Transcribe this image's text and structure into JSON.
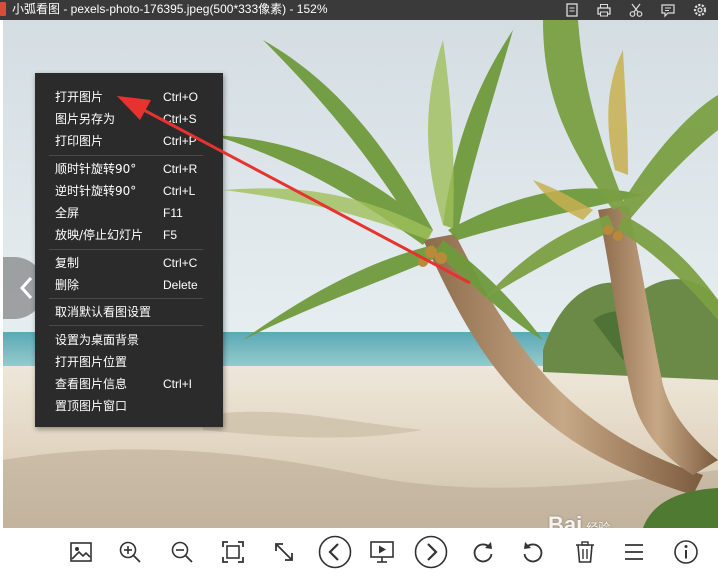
{
  "window": {
    "title": "小弧看图 - pexels-photo-176395.jpeg(500*333像素) - 152%"
  },
  "title_icons": [
    "crop-icon",
    "print-icon",
    "scissors-icon",
    "feedback-icon",
    "settings-icon"
  ],
  "context_menu": {
    "items": [
      {
        "label": "打开图片",
        "shortcut": "Ctrl+O"
      },
      {
        "label": "图片另存为",
        "shortcut": "Ctrl+S"
      },
      {
        "label": "打印图片",
        "shortcut": "Ctrl+P"
      },
      {
        "label": "顺时针旋转90°",
        "shortcut": "Ctrl+R"
      },
      {
        "label": "逆时针旋转90°",
        "shortcut": "Ctrl+L"
      },
      {
        "label": "全屏",
        "shortcut": "F11"
      },
      {
        "label": "放映/停止幻灯片",
        "shortcut": "F5"
      },
      {
        "label": "复制",
        "shortcut": "Ctrl+C"
      },
      {
        "label": "删除",
        "shortcut": "Delete"
      },
      {
        "label": "取消默认看图设置",
        "shortcut": ""
      },
      {
        "label": "设置为桌面背景",
        "shortcut": ""
      },
      {
        "label": "打开图片位置",
        "shortcut": ""
      },
      {
        "label": "查看图片信息",
        "shortcut": "Ctrl+I"
      },
      {
        "label": "置顶图片窗口",
        "shortcut": ""
      }
    ]
  },
  "toolbar_icons": [
    "image-icon",
    "zoom-in-icon",
    "zoom-out-icon",
    "fit-screen-icon",
    "actual-size-icon",
    "previous-icon",
    "slideshow-icon",
    "next-icon",
    "rotate-clockwise-icon",
    "rotate-counterclockwise-icon",
    "delete-icon",
    "menu-icon",
    "info-icon"
  ],
  "watermark": {
    "text": "Bai",
    "sub": "经验"
  },
  "colors": {
    "titlebar": "#3a3a3a",
    "menu_bg": "#2b2b2b",
    "arrow": "#e8322f",
    "sky": "#d9e6ec",
    "sea": "#6fb8c2",
    "sand": "#e9dfcf"
  }
}
